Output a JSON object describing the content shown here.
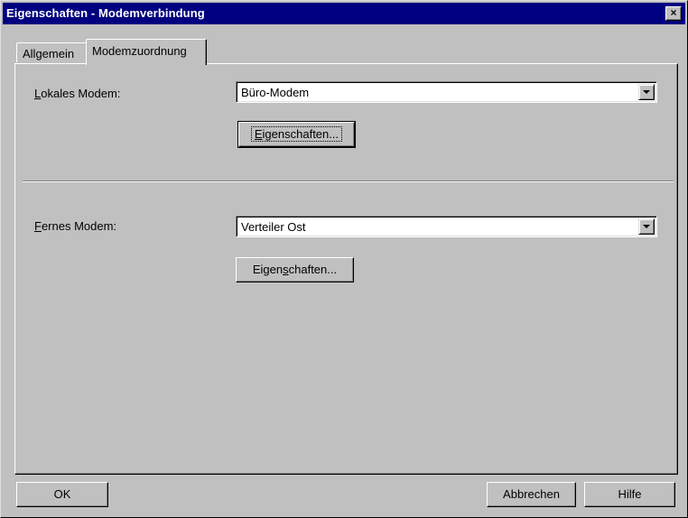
{
  "window": {
    "title": "Eigenschaften - Modemverbindung",
    "close_label": "×"
  },
  "tabs": [
    {
      "label": "Allgemein"
    },
    {
      "label": "Modemzuordnung"
    }
  ],
  "local": {
    "label_mnemonic": "L",
    "label_rest": "okales Modem:",
    "value": "Büro-Modem",
    "button_before": "",
    "button_mnemonic": "E",
    "button_after": "igenschaften..."
  },
  "remote": {
    "label_mnemonic": "F",
    "label_rest": "ernes Modem:",
    "value": "Verteiler Ost",
    "button_before": "Eigen",
    "button_mnemonic": "s",
    "button_after": "chaften..."
  },
  "footer": {
    "ok": "OK",
    "cancel": "Abbrechen",
    "help": "Hilfe"
  }
}
